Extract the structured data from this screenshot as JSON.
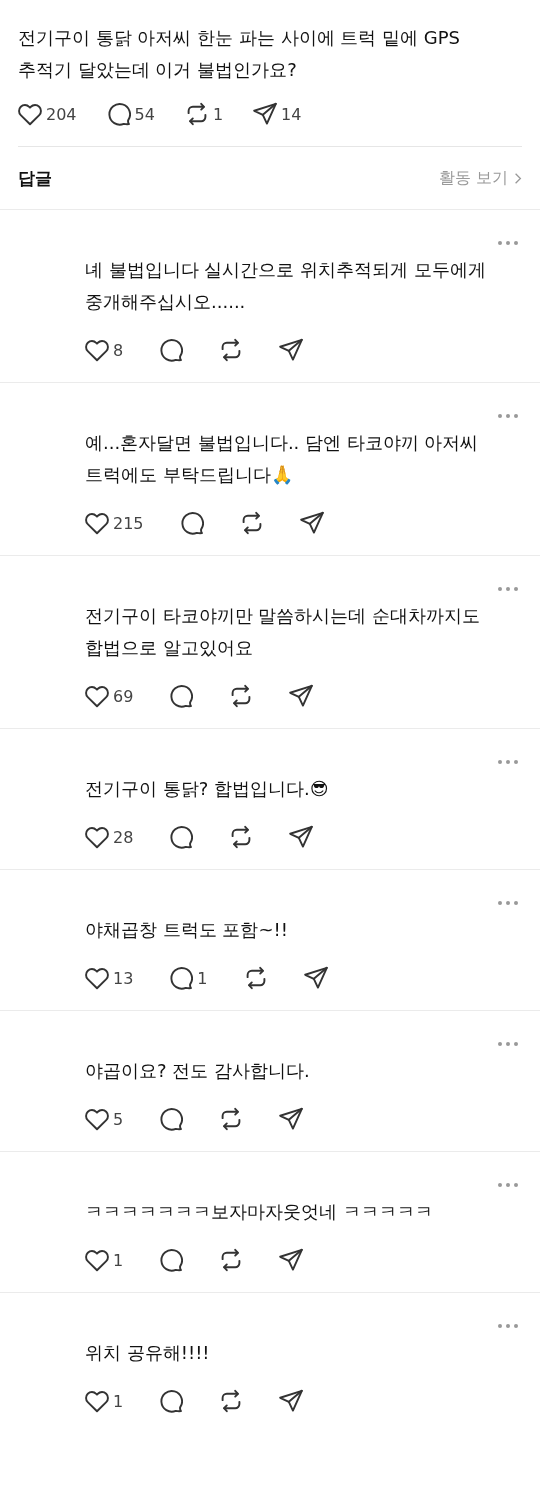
{
  "post": {
    "text": "전기구이 통닭 아저씨 한눈 파는 사이에 트럭 밑에 GPS 추적기 달았는데 이거 불법인가요?",
    "likes": "204",
    "comments": "54",
    "reposts": "1",
    "shares": "14"
  },
  "replies_header": {
    "title": "답글",
    "activity_link": "활동 보기"
  },
  "replies": [
    {
      "text": "녜 불법입니다 실시간으로 위치추적되게 모두에게 중개해주십시오......",
      "likes": "8"
    },
    {
      "text": "예...혼자달면 불법입니다.. 담엔 타코야끼 아저씨 트럭에도 부탁드립니다🙏",
      "likes": "215"
    },
    {
      "text": "전기구이 타코야끼만 말씀하시는데 순대차까지도 합법으로 알고있어요",
      "likes": "69"
    },
    {
      "text": "전기구이 통닭? 합법입니다.😎",
      "likes": "28"
    },
    {
      "text": "야채곱창 트럭도 포함~!!",
      "likes": "13",
      "comments": "1"
    },
    {
      "text": "야곱이요? 전도 감사합니다.",
      "likes": "5"
    },
    {
      "text": "ㅋㅋㅋㅋㅋㅋㅋ보자마자웃엇네 ㅋㅋㅋㅋㅋ",
      "likes": "1"
    },
    {
      "text": "위치 공유해!!!!",
      "likes": "1"
    }
  ]
}
